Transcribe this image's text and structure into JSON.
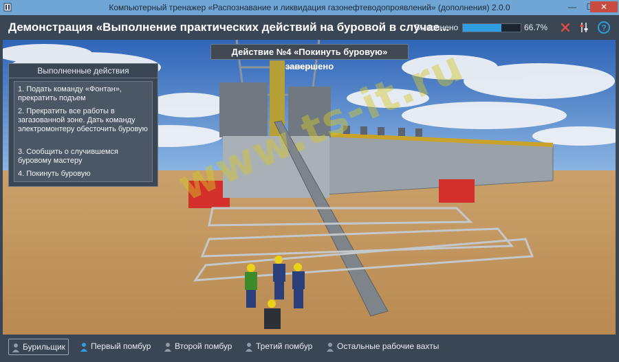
{
  "window": {
    "title": "Компьютерный тренажер «Распознавание и ликвидация газонефтеводопроявлений» (дополнения) 2.0.0",
    "minimize_glyph": "—",
    "maximize_glyph": "☐",
    "close_glyph": "✕"
  },
  "header": {
    "title": "Демонстрация «Выполнение практических действий на буровой в случае...",
    "progress_label": "Выполнено",
    "progress_value": 0.667,
    "progress_text": "66.7%",
    "icons": [
      "close-icon",
      "settings-icon",
      "help-icon"
    ]
  },
  "banner": {
    "text": "Действие №4 «Покинуть буровую» завершено"
  },
  "actions_panel": {
    "title": "Выполненные действия",
    "items": [
      "1. Подать команду «Фонтан», прекратить подъем",
      "2. Прекратить все работы в загазованной зоне. Дать команду электромонтеру обесточить буровую",
      "3. Сообщить о случившемся буровому мастеру",
      "4. Покинуть буровую"
    ]
  },
  "watermark": "www.ts-it.ru",
  "roles": [
    {
      "label": "Бурильщик",
      "active": true
    },
    {
      "label": "Первый помбур",
      "active": false
    },
    {
      "label": "Второй помбур",
      "active": false
    },
    {
      "label": "Третий помбур",
      "active": false
    },
    {
      "label": "Остальные рабочие вахты",
      "active": false
    }
  ],
  "colors": {
    "accent": "#2f9ee0",
    "panel": "#3a4654",
    "close_red": "#e04b3c"
  }
}
